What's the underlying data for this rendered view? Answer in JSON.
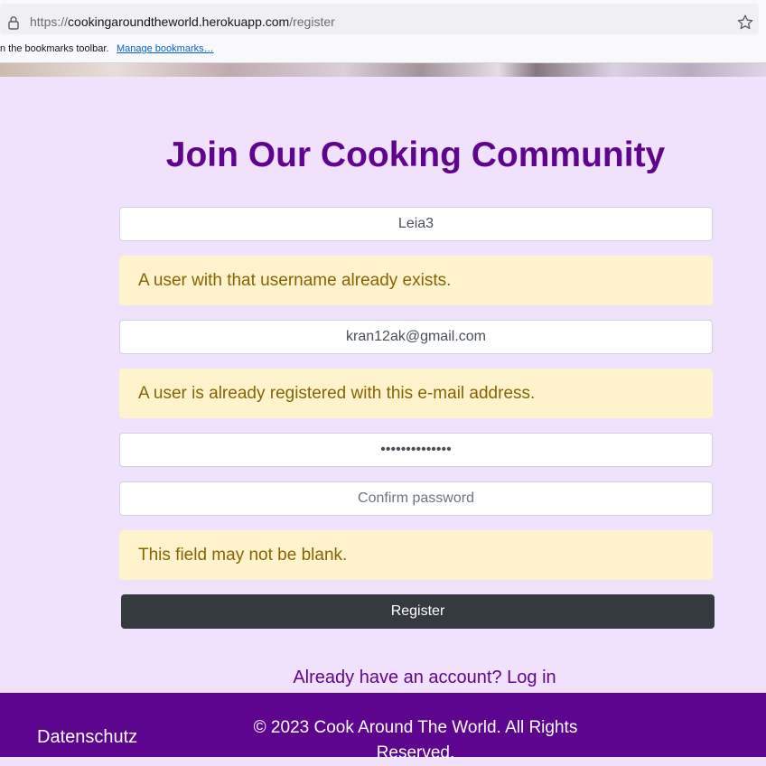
{
  "browser": {
    "url_scheme": "https://",
    "url_domain": "cookingaroundtheworld.herokuapp.com",
    "url_path": "/register",
    "bookmarks_message": "n the bookmarks toolbar.",
    "manage_bookmarks": "Manage bookmarks…"
  },
  "page": {
    "title": "Join Our Cooking Community"
  },
  "form": {
    "username_value": "Leia3",
    "username_error": "A user with that username already exists.",
    "email_value": "kran12ak@gmail.com",
    "email_error": "A user is already registered with this e-mail address.",
    "password_value": "••••••••••••••",
    "confirm_placeholder": "Confirm password",
    "confirm_error": "This field may not be blank.",
    "register_label": "Register"
  },
  "login_prompt": {
    "text": "Already have an account? ",
    "link": "Log in"
  },
  "footer": {
    "privacy": "Datenschutz",
    "copyright": "© 2023 Cook Around The World. All Rights Reserved."
  },
  "colors": {
    "background": "#f0e1fd",
    "brand_purple": "#5e058f",
    "alert_bg": "#fff3cd",
    "alert_text": "#856404",
    "button_dark": "#343a40"
  }
}
